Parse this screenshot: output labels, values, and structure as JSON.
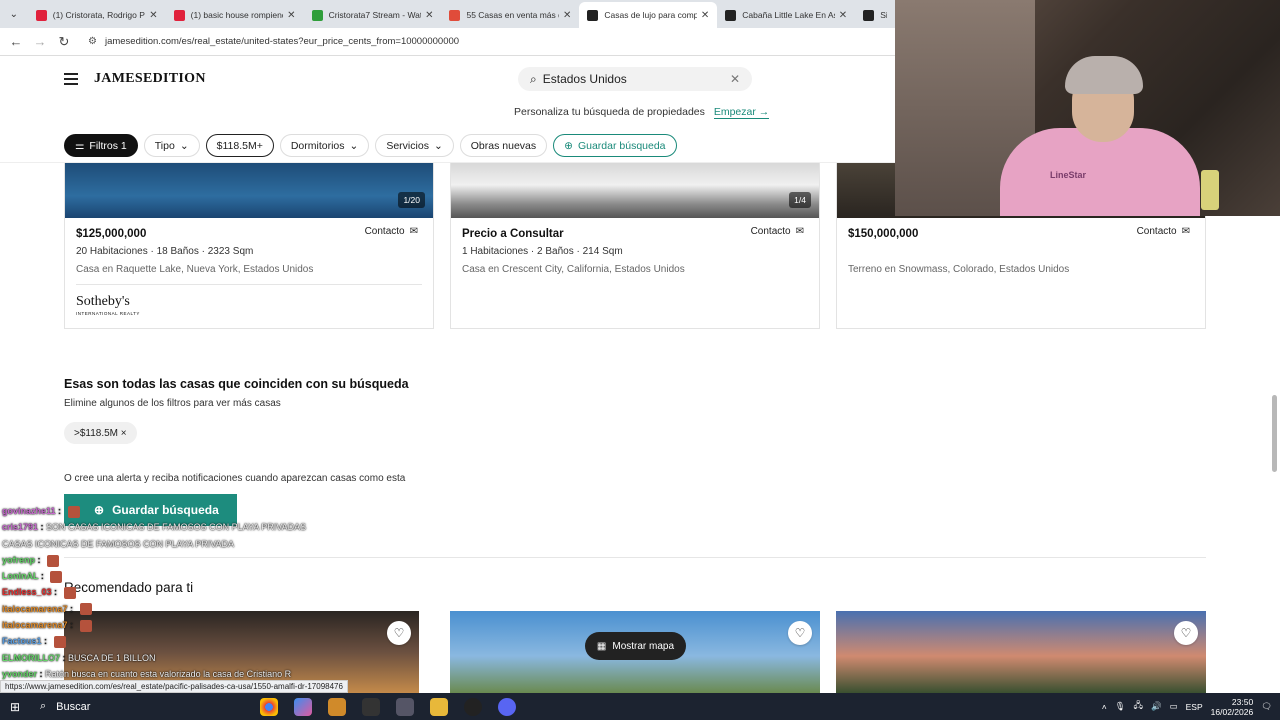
{
  "browser": {
    "tabs": [
      {
        "title": "(1) Cristorata, Rodrigo Pu…",
        "favicon_color": "#e0213c"
      },
      {
        "title": "(1) basic house rompiendo…",
        "favicon_color": "#e0213c"
      },
      {
        "title": "Cristorata7 Stream - Watc…",
        "favicon_color": "#2f9e3a"
      },
      {
        "title": "55 Casas en venta más de…",
        "favicon_color": "#e04c3a"
      },
      {
        "title": "Casas de lujo para compr…",
        "favicon_color": "#222222",
        "active": true
      },
      {
        "title": "Cabaña Little Lake En Asp…",
        "favicon_color": "#222222"
      },
      {
        "title": "Sing",
        "favicon_color": "#222222"
      }
    ],
    "url": "jamesedition.com/es/real_estate/united-states?eur_price_cents_from=10000000000",
    "status_url": "https://www.jamesedition.com/es/real_estate/pacific-palisades-ca-usa/1550-amalfi-dr-17098476"
  },
  "header": {
    "logo": "JAMESEDITION",
    "search_value": "Estados Unidos",
    "personalize_text": "Personaliza tu búsqueda de propiedades",
    "personalize_link": "Empezar →"
  },
  "filters": {
    "filtros": "Filtros 1",
    "tipo": "Tipo",
    "price": "$118.5M+",
    "dormitorios": "Dormitorios",
    "servicios": "Servicios",
    "obras": "Obras nuevas",
    "guardar": "Guardar búsqueda"
  },
  "listings": [
    {
      "price": "$125,000,000",
      "contact": "Contacto",
      "specs": "20 Habitaciones · 18 Baños · 2323 Sqm",
      "location": "Casa en Raquette Lake, Nueva York, Estados Unidos",
      "badge": "1/20",
      "agency": "Sotheby's",
      "agency_sub": "INTERNATIONAL REALTY"
    },
    {
      "price": "Precio a Consultar",
      "contact": "Contacto",
      "specs": "1 Habitaciones · 2 Baños · 214 Sqm",
      "location": "Casa en Crescent City, California, Estados Unidos",
      "badge": "1/4"
    },
    {
      "price": "$150,000,000",
      "contact": "Contacto",
      "specs": "",
      "location": "Terreno en Snowmass, Colorado, Estados Unidos"
    }
  ],
  "end_of_results": {
    "title": "Esas son todas las casas que coinciden con su búsqueda",
    "subtitle": "Elimine algunos de los filtros para ver más casas",
    "chip": ">$118.5M ×",
    "alert_text": "O cree una alerta y reciba notificaciones cuando aparezcan casas como esta",
    "save_button": "Guardar búsqueda"
  },
  "recommended": {
    "title": "Recomendado para ti",
    "map_button": "Mostrar mapa"
  },
  "webcam": {
    "shirt_text": "LineStar"
  },
  "chat": [
    {
      "user": "govinazhe11",
      "color": "#c96bd0",
      "msg": ""
    },
    {
      "user": "cris1791",
      "color": "#c96bd0",
      "msg": "SON CASAS ICONICAS DE FAMOSOS CON PLAYA PRIVADAS"
    },
    {
      "user": "",
      "color": "#c96bd0",
      "msg": "CASAS ICONICAS DE FAMOSOS CON PLAYA PRIVADA"
    },
    {
      "user": "yofrenp",
      "color": "#66d66a",
      "msg": ""
    },
    {
      "user": "LoninAL",
      "color": "#66d66a",
      "msg": ""
    },
    {
      "user": "Endless_03",
      "color": "#e03131",
      "msg": ""
    },
    {
      "user": "italocamarena7",
      "color": "#e08b2a",
      "msg": ""
    },
    {
      "user": "italocamarena7",
      "color": "#e08b2a",
      "msg": ""
    },
    {
      "user": "Factous1",
      "color": "#5b9ee0",
      "msg": ""
    },
    {
      "user": "ELMORILLO7",
      "color": "#66d66a",
      "msg": "BUSCA DE 1 BILLON"
    },
    {
      "user": "yvonder",
      "color": "#66d66a",
      "msg": "Ratón busca en cuanto esta valorizado la casa de Cristiano R"
    },
    {
      "user": "italocamarena7",
      "color": "#e08b2a",
      "msg": ""
    }
  ],
  "taskbar": {
    "search": "Buscar",
    "lang": "ESP",
    "time": "23:50",
    "date": "16/02/2026"
  }
}
